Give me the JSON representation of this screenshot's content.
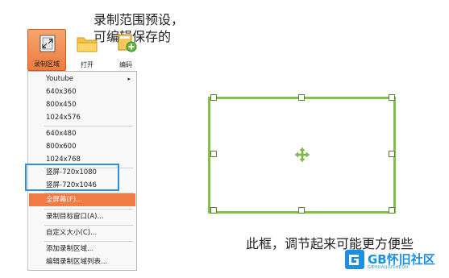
{
  "annotations": {
    "top_line1": "录制范围预设，",
    "top_line2": "可编辑保存的",
    "bottom": "此框，调节起来可能更方便些"
  },
  "toolbar": {
    "record_area_label": "录制区域",
    "open_label": "打开",
    "encode_label": "编码"
  },
  "menu": {
    "items": [
      {
        "label": "Youtube",
        "has_submenu": true
      },
      {
        "label": "640x360"
      },
      {
        "label": "800x450"
      },
      {
        "label": "1024x576"
      },
      {
        "label": "640x480"
      },
      {
        "label": "800x600"
      },
      {
        "label": "1024x768"
      },
      {
        "label": "竖屏-720x1080"
      },
      {
        "label": "竖屏-720x1046"
      },
      {
        "label": "全屏幕(F)...",
        "highlighted": true
      },
      {
        "label": "录制目标窗口(A)..."
      },
      {
        "label": "自定义大小(C)..."
      },
      {
        "label": "添加录制区域..."
      },
      {
        "label": "编辑录制区域列表..."
      }
    ],
    "submenu_arrow": "▸"
  },
  "watermark": {
    "brand": "GB怀旧社区",
    "sub": "GBHUAIJIUSHEQU"
  },
  "colors": {
    "frame_green": "#84c048",
    "highlight_orange": "#ef7b45",
    "annotation_blue": "#2f8fdc",
    "brand_blue": "#1b8fe0"
  }
}
